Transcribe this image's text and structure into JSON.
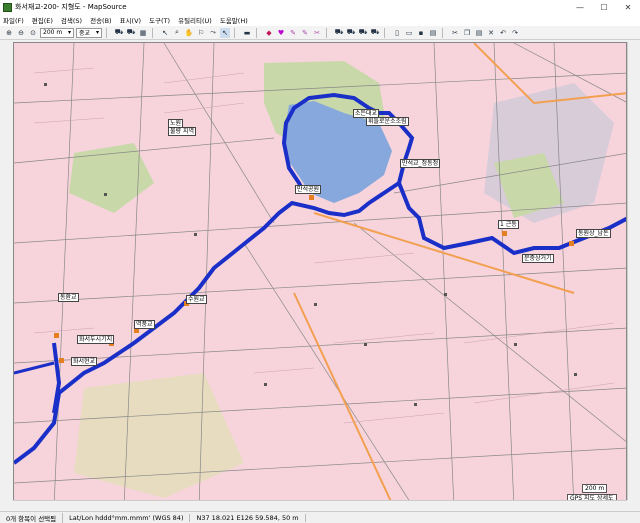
{
  "window": {
    "title": "화서재교-200- 지형도 - MapSource",
    "minimize": "—",
    "maximize": "☐",
    "close": "✕"
  },
  "menu": [
    "파일(F)",
    "편집(E)",
    "검색(S)",
    "전송(B)",
    "표시(V)",
    "도구(T)",
    "유틸리티(U)",
    "도움말(H)"
  ],
  "toolbar": {
    "zoom_value": "200 m",
    "detail_value": "중교"
  },
  "map": {
    "labels": {
      "reservoir_marker": "소든대교",
      "cafe": "휘들로운소조림",
      "park": "노원",
      "danger": "불량 지역",
      "pavilion": "만석공원",
      "station1": "만석교_정동정",
      "turn1": "1 근동",
      "bus": "동원상_남돈",
      "point3": "문중상거기",
      "bridge1": "동환교",
      "bridge2": "수원교",
      "market": "역풍교",
      "road1": "화서두시기지",
      "road2": "화서현교"
    },
    "scale_text": "200 m",
    "map_source": "GPS 지도 상세도"
  },
  "status": {
    "waypoints": "0개 항목이 선택됨",
    "coord_format": "Lat/Lon hddd°mm.mmm' (WGS 84)",
    "coords": "N37 18.021 E126 59.584, 50 m"
  },
  "colors": {
    "map_bg": "#f7d4dc",
    "water": "#87a8dc",
    "park": "#c8d8a8",
    "track": "#1a2ec8"
  }
}
